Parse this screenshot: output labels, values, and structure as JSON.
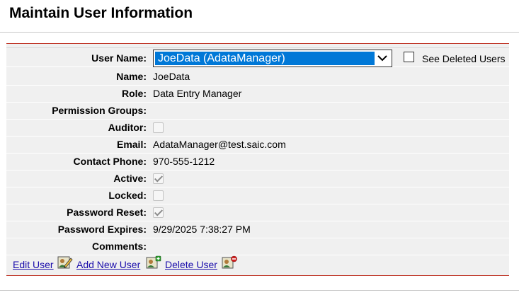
{
  "page": {
    "title": "Maintain User Information"
  },
  "user_select": {
    "label": "User Name:",
    "selected": "JoeData (AdataManager)"
  },
  "see_deleted": {
    "label": "See Deleted Users",
    "checked": false
  },
  "fields": {
    "name": {
      "label": "Name:",
      "value": "JoeData"
    },
    "role": {
      "label": "Role:",
      "value": "Data Entry Manager"
    },
    "permission_groups": {
      "label": "Permission Groups:",
      "value": ""
    },
    "auditor": {
      "label": "Auditor:",
      "checked": false
    },
    "email": {
      "label": "Email:",
      "value": "AdataManager@test.saic.com"
    },
    "contact_phone": {
      "label": "Contact Phone:",
      "value": "970-555-1212"
    },
    "active": {
      "label": "Active:",
      "checked": true
    },
    "locked": {
      "label": "Locked:",
      "checked": false
    },
    "password_reset": {
      "label": "Password Reset:",
      "checked": true
    },
    "password_expires": {
      "label": "Password Expires:",
      "value": "9/29/2025 7:38:27 PM"
    },
    "comments": {
      "label": "Comments:",
      "value": ""
    }
  },
  "actions": {
    "edit_user": "Edit User",
    "add_new_user": "Add New User",
    "delete_user": "Delete User"
  },
  "icons": {
    "edit": "user-edit-icon",
    "add": "user-add-icon",
    "delete": "user-delete-icon"
  },
  "colors": {
    "panel_border": "#c0392b",
    "selection": "#0078d7",
    "link": "#1a0dab"
  }
}
